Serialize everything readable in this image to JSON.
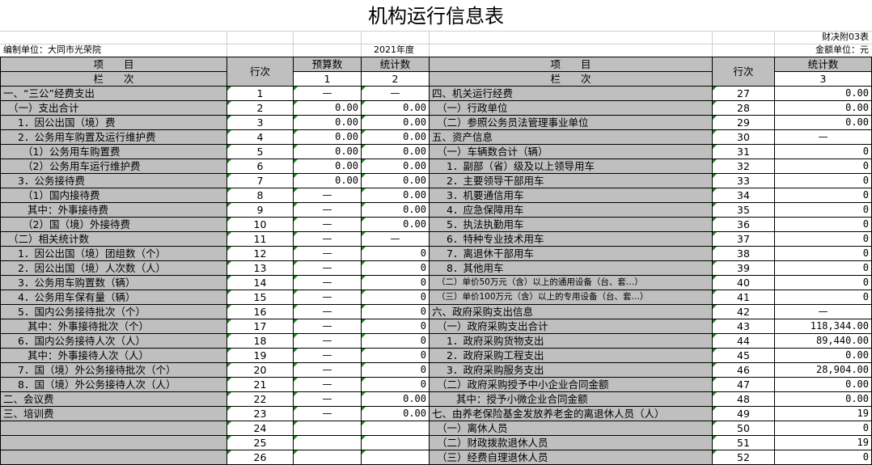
{
  "title": "机构运行信息表",
  "form_no": "财决附03表",
  "unit": "编制单位：大同市光荣院",
  "year": "2021年度",
  "amount_unit": "金额单位：元",
  "headers": {
    "item_top": "项　　目",
    "item_bottom": "栏　　次",
    "row_no": "行次",
    "budget": "预算数",
    "stat": "统计数",
    "col1": "1",
    "col2": "2",
    "col3": "3"
  },
  "rows": [
    {
      "l": "一、“三公”经费支出",
      "ln": "1",
      "b": "—",
      "s": "—",
      "r": "四、机关运行经费",
      "rn": "27",
      "rv": "0.00"
    },
    {
      "l": "（一）支出合计",
      "ln": "2",
      "b": "0.00",
      "s": "0.00",
      "r": "（一）行政单位",
      "rn": "28",
      "rv": "0.00"
    },
    {
      "l": "1．因公出国（境）费",
      "ln": "3",
      "b": "0.00",
      "s": "0.00",
      "r": "（二）参照公务员法管理事业单位",
      "rn": "29",
      "rv": "0.00"
    },
    {
      "l": "2．公务用车购置及运行维护费",
      "ln": "4",
      "b": "0.00",
      "s": "0.00",
      "r": "五、资产信息",
      "rn": "30",
      "rv": "—"
    },
    {
      "l": "（1）公务用车购置费",
      "ln": "5",
      "b": "0.00",
      "s": "0.00",
      "r": "（一）车辆数合计（辆）",
      "rn": "31",
      "rv": "0"
    },
    {
      "l": "（2）公务用车运行维护费",
      "ln": "6",
      "b": "0.00",
      "s": "0.00",
      "r": "1．副部（省）级及以上领导用车",
      "rn": "32",
      "rv": "0"
    },
    {
      "l": "3．公务接待费",
      "ln": "7",
      "b": "0.00",
      "s": "0.00",
      "r": "2．主要领导干部用车",
      "rn": "33",
      "rv": "0"
    },
    {
      "l": "（1）国内接待费",
      "ln": "8",
      "b": "—",
      "s": "0.00",
      "r": "3．机要通信用车",
      "rn": "34",
      "rv": "0"
    },
    {
      "l": "其中：外事接待费",
      "ln": "9",
      "b": "—",
      "s": "0.00",
      "r": "4．应急保障用车",
      "rn": "35",
      "rv": "0"
    },
    {
      "l": "（2）国（境）外接待费",
      "ln": "10",
      "b": "—",
      "s": "0.00",
      "r": "5．执法执勤用车",
      "rn": "36",
      "rv": "0"
    },
    {
      "l": "（二）相关统计数",
      "ln": "11",
      "b": "—",
      "s": "—",
      "r": "6．特种专业技术用车",
      "rn": "37",
      "rv": "0"
    },
    {
      "l": "1．因公出国（境）团组数（个）",
      "ln": "12",
      "b": "—",
      "s": "0",
      "r": "7．离退休干部用车",
      "rn": "38",
      "rv": "0"
    },
    {
      "l": "2．因公出国（境）人次数（人）",
      "ln": "13",
      "b": "—",
      "s": "0",
      "r": "8．其他用车",
      "rn": "39",
      "rv": "0"
    },
    {
      "l": "3．公务用车购置数（辆）",
      "ln": "14",
      "b": "—",
      "s": "0",
      "r": "（二）单价50万元（含）以上的通用设备（台、套…）",
      "rn": "40",
      "rv": "0"
    },
    {
      "l": "4．公务用车保有量（辆）",
      "ln": "15",
      "b": "—",
      "s": "0",
      "r": "（三）单价100万元（含）以上的专用设备（台、套…）",
      "rn": "41",
      "rv": "0"
    },
    {
      "l": "5．国内公务接待批次（个）",
      "ln": "16",
      "b": "—",
      "s": "0",
      "r": "六、政府采购支出信息",
      "rn": "42",
      "rv": "—"
    },
    {
      "l": "其中：外事接待批次（个）",
      "ln": "17",
      "b": "—",
      "s": "0",
      "r": "（一）政府采购支出合计",
      "rn": "43",
      "rv": "118,344.00"
    },
    {
      "l": "6．国内公务接待人次（人）",
      "ln": "18",
      "b": "—",
      "s": "0",
      "r": "1．政府采购货物支出",
      "rn": "44",
      "rv": "89,440.00"
    },
    {
      "l": "其中：外事接待人次（人）",
      "ln": "19",
      "b": "—",
      "s": "0",
      "r": "2．政府采购工程支出",
      "rn": "45",
      "rv": "0.00"
    },
    {
      "l": "7．国（境）外公务接待批次（个）",
      "ln": "20",
      "b": "—",
      "s": "0",
      "r": "3．政府采购服务支出",
      "rn": "46",
      "rv": "28,904.00"
    },
    {
      "l": "8．国（境）外公务接待人次（人）",
      "ln": "21",
      "b": "—",
      "s": "0",
      "r": "（二）政府采购授予中小企业合同金额",
      "rn": "47",
      "rv": "0.00"
    },
    {
      "l": "二、会议费",
      "ln": "22",
      "b": "—",
      "s": "0.00",
      "r": "其中：授予小微企业合同金额",
      "rn": "48",
      "rv": "0.00"
    },
    {
      "l": "三、培训费",
      "ln": "23",
      "b": "—",
      "s": "0.00",
      "r": "七、由养老保险基金发放养老金的离退休人员（人）",
      "rn": "49",
      "rv": "19"
    },
    {
      "l": "",
      "ln": "24",
      "b": "",
      "s": "",
      "r": "（一）离休人员",
      "rn": "50",
      "rv": "0"
    },
    {
      "l": "",
      "ln": "25",
      "b": "",
      "s": "",
      "r": "（二）财政拨款退休人员",
      "rn": "51",
      "rv": "19"
    },
    {
      "l": "",
      "ln": "26",
      "b": "",
      "s": "",
      "r": "（三）经费自理退休人员",
      "rn": "52",
      "rv": "0"
    }
  ]
}
